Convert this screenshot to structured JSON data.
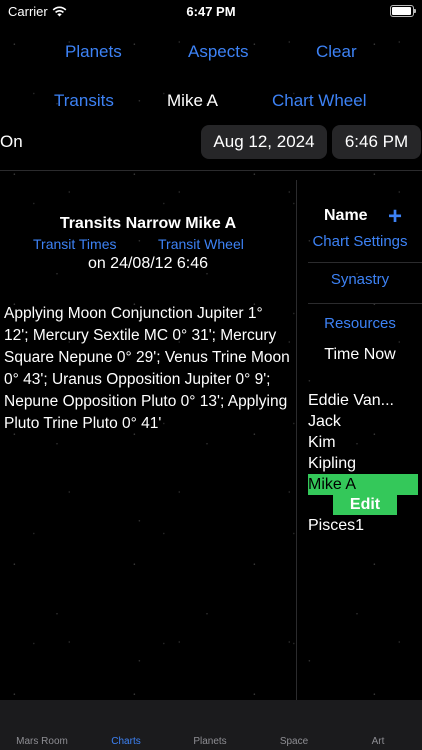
{
  "status_bar": {
    "carrier": "Carrier",
    "time": "6:47 PM"
  },
  "nav": {
    "planets": "Planets",
    "aspects": "Aspects",
    "clear": "Clear",
    "transits": "Transits",
    "subject": "Mike A",
    "chart_wheel": "Chart Wheel"
  },
  "date_row": {
    "on_label": "On",
    "date": "Aug 12, 2024",
    "time": "6:46 PM"
  },
  "report": {
    "title": "Transits Narrow  Mike A",
    "transit_times": "Transit Times",
    "transit_wheel": "Transit Wheel",
    "date_line": "on 24/08/12 6:46",
    "body": "Applying Moon Conjunction Jupiter 1° 12'; Mercury Sextile MC 0° 31'; Mercury Square Nepune 0° 29'; Venus Trine Moon 0° 43'; Uranus Opposition Jupiter 0° 9'; Nepune Opposition Pluto 0° 13'; Applying Pluto Trine Pluto 0° 41'"
  },
  "sidebar": {
    "name_label": "Name",
    "plus": "+",
    "chart_settings": "Chart Settings",
    "synastry": "Synastry",
    "resources": "Resources",
    "time_now": "Time Now",
    "charts": [
      "Eddie Van...",
      "Jack",
      "Kim",
      "Kipling",
      "Mike A",
      "Pisces1"
    ],
    "selected_index": 4,
    "edit_label": "Edit"
  },
  "tabs": [
    {
      "label": "Mars Room",
      "active": false
    },
    {
      "label": "Charts",
      "active": true
    },
    {
      "label": "Planets",
      "active": false
    },
    {
      "label": "Space",
      "active": false
    },
    {
      "label": "Art",
      "active": false
    }
  ],
  "colors": {
    "accent": "#3d82f5",
    "selected": "#34c85a",
    "pill": "#262628"
  }
}
